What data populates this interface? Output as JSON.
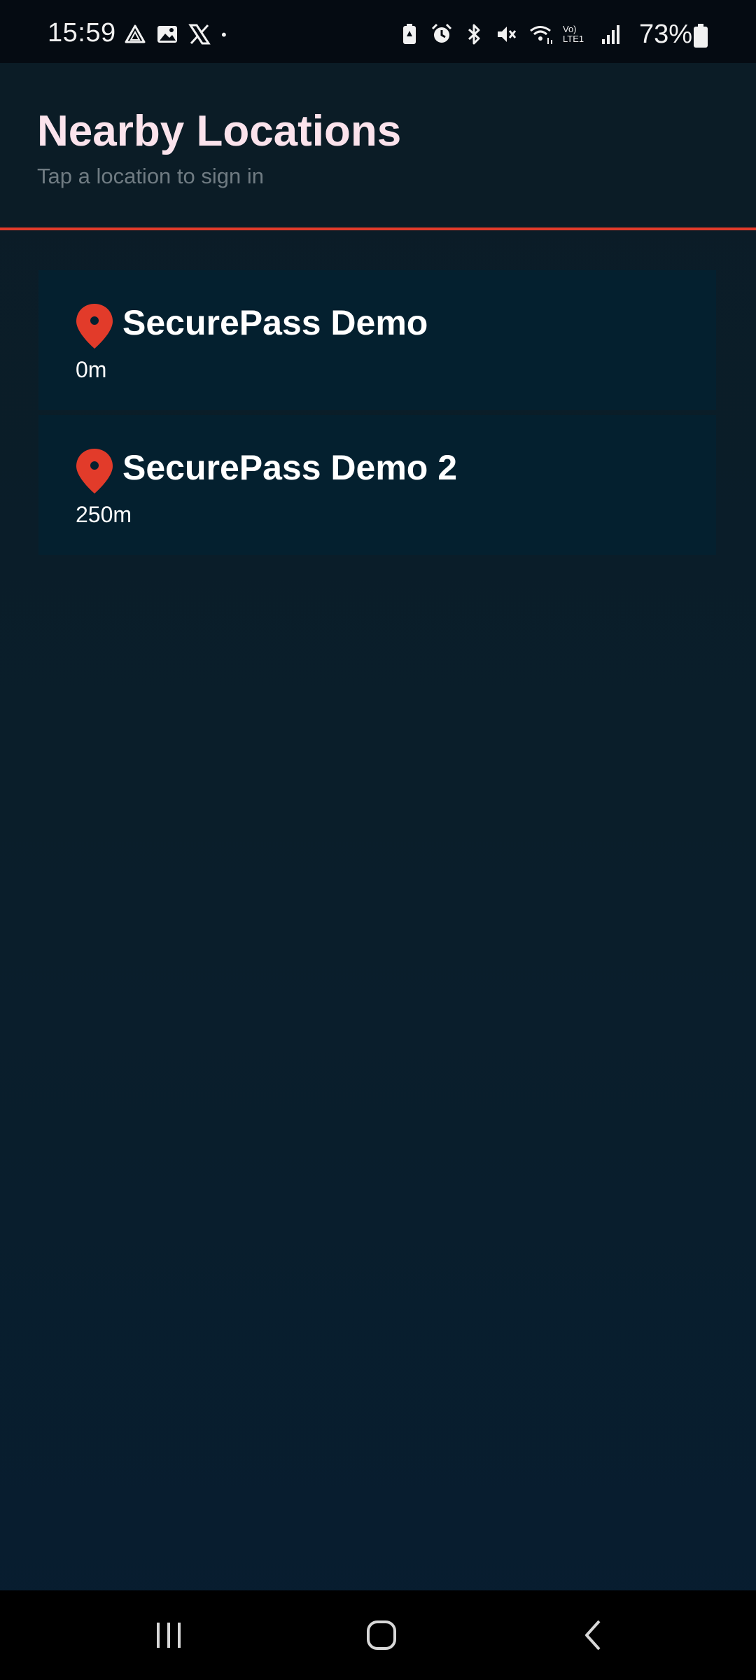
{
  "status_bar": {
    "time": "15:59",
    "battery_percent": "73%",
    "left_icons": [
      "triangle-app-icon",
      "image-icon",
      "x-logo-icon",
      "dot-icon"
    ],
    "right_icons": [
      "battery-saver-icon",
      "alarm-icon",
      "bluetooth-icon",
      "mute-icon",
      "wifi-icon",
      "volte-icon",
      "signal-icon",
      "battery-icon"
    ],
    "volte_text": "Vo) LTE1"
  },
  "header": {
    "title": "Nearby Locations",
    "subtitle": "Tap a location to sign in"
  },
  "locations": [
    {
      "name": "SecurePass Demo",
      "distance": "0m",
      "icon": "map-pin-icon"
    },
    {
      "name": "SecurePass Demo 2",
      "distance": "250m",
      "icon": "map-pin-icon"
    }
  ],
  "nav_bar": {
    "buttons": [
      "recent-apps-icon",
      "home-icon",
      "back-icon"
    ]
  },
  "colors": {
    "accent": "#e23b2a",
    "background": "#0b1c26",
    "card": "#04202f",
    "title": "#fbe3ec",
    "subtitle": "#6f7b82"
  }
}
